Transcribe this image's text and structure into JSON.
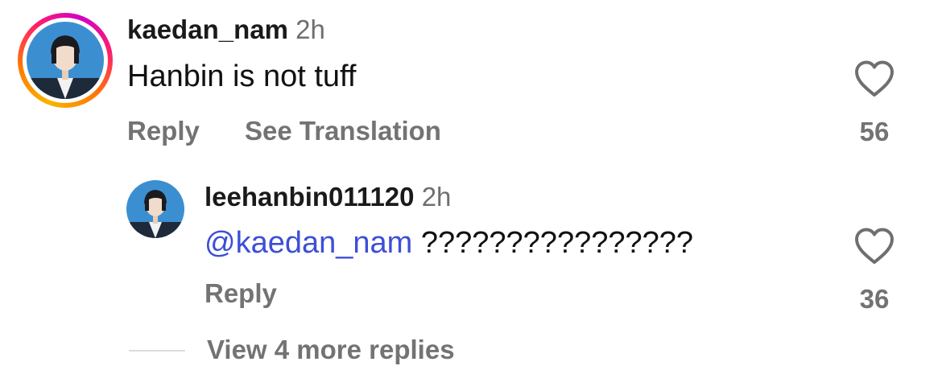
{
  "comment": {
    "username": "kaedan_nam",
    "time": "2h",
    "text": "Hanbin is not tuff",
    "reply_label": "Reply",
    "translate_label": "See Translation",
    "like_count": "56",
    "like_icon": "heart-outline-icon"
  },
  "reply": {
    "username": "leehanbin011120",
    "time": "2h",
    "mention": "@kaedan_nam",
    "text": "????????????????",
    "reply_label": "Reply",
    "like_count": "36",
    "like_icon": "heart-outline-icon"
  },
  "more_replies": {
    "label": "View 4 more replies"
  },
  "colors": {
    "mention": "#3d4fd6",
    "meta_text": "#737373",
    "avatar_background": "#3b8fd0",
    "story_ring": [
      "#f7b500",
      "#ff7a00",
      "#ff1f6b",
      "#d300c5"
    ]
  }
}
